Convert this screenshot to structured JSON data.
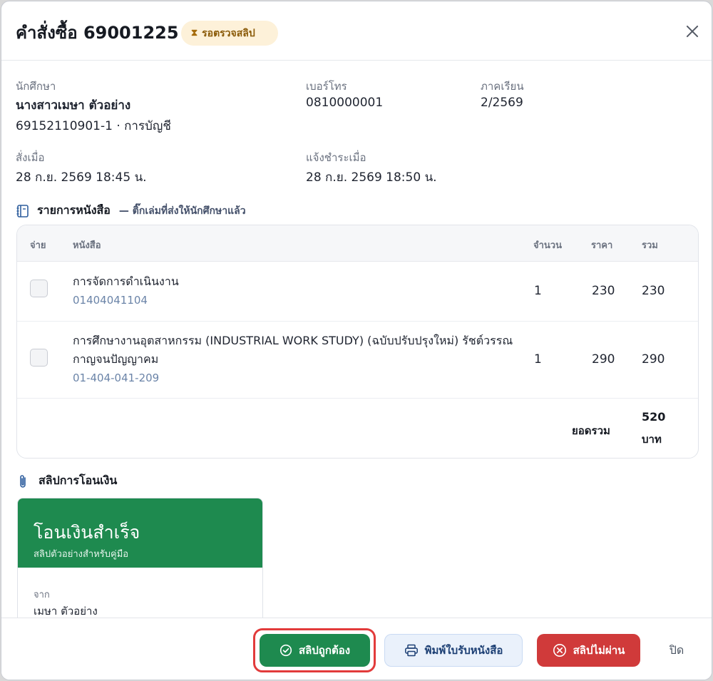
{
  "header": {
    "title": "คำสั่งซื้อ 69001225",
    "status_badge": "รอตรวจสลิป",
    "status_icon": "hourglass-icon",
    "close_icon": "close-icon"
  },
  "info": {
    "student_label": "นักศึกษา",
    "student_name": "นางสาวเมษา ตัวอย่าง",
    "student_id_major": "69152110901-1 · การบัญชี",
    "phone_label": "เบอร์โทร",
    "phone_value": "0810000001",
    "semester_label": "ภาคเรียน",
    "semester_value": "2/2569",
    "ordered_label": "สั่งเมื่อ",
    "ordered_value": "28 ก.ย. 2569 18:45 น.",
    "paid_label": "แจ้งชำระเมื่อ",
    "paid_value": "28 ก.ย. 2569 18:50 น."
  },
  "books_section": {
    "title": "รายการหนังสือ",
    "subtitle": "— ติ๊กเล่มที่ส่งให้นักศึกษาแล้ว",
    "icon": "book-icon",
    "columns": {
      "given": "จ่าย",
      "book": "หนังสือ",
      "qty": "จำนวน",
      "price": "ราคา",
      "total": "รวม"
    },
    "rows": [
      {
        "title": "การจัดการดำเนินงาน",
        "code": "01404041104",
        "qty": "1",
        "price": "230",
        "total": "230",
        "checked": false
      },
      {
        "title": "การศึกษางานอุตสาหกรรม (INDUSTRIAL WORK STUDY) (ฉบับปรับปรุงใหม่) รัชต์วรรณ กาญจนปัญญาคม",
        "code": "01-404-041-209",
        "qty": "1",
        "price": "290",
        "total": "290",
        "checked": false
      }
    ],
    "grand_total_label": "ยอดรวม",
    "grand_total_amount": "520",
    "grand_total_unit": "บาท"
  },
  "slip_section": {
    "title": "สลิปการโอนเงิน",
    "icon": "paperclip-icon",
    "slip_heading": "โอนเงินสำเร็จ",
    "slip_subheading": "สลิปตัวอย่างสำหรับคู่มือ",
    "from_label": "จาก",
    "from_value": "เมษา ตัวอย่าง",
    "brand_color": "#1e8a4f"
  },
  "footer": {
    "approve_label": "สลิปถูกต้อง",
    "print_label": "พิมพ์ใบรับหนังสือ",
    "reject_label": "สลิปไม่ผ่าน",
    "close_label": "ปิด",
    "approve_color": "#1e8a4f",
    "reject_color": "#d03a3a"
  }
}
